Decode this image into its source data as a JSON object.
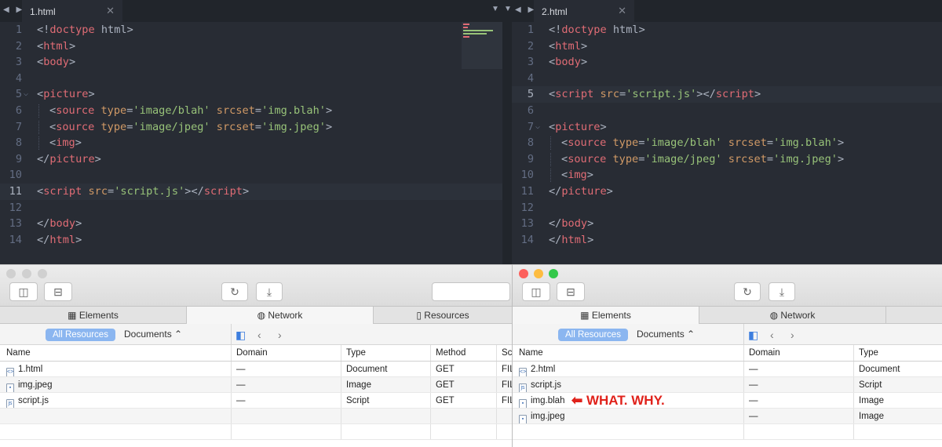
{
  "editor_left": {
    "tab_title": "1.html",
    "lines": [
      {
        "n": "1",
        "tokens": [
          [
            "p",
            "<!"
          ],
          [
            "t",
            "doctype"
          ],
          [
            "k",
            " html"
          ],
          [
            "p",
            ">"
          ]
        ]
      },
      {
        "n": "2",
        "tokens": [
          [
            "p",
            "<"
          ],
          [
            "t",
            "html"
          ],
          [
            "p",
            ">"
          ]
        ]
      },
      {
        "n": "3",
        "tokens": [
          [
            "p",
            "<"
          ],
          [
            "t",
            "body"
          ],
          [
            "p",
            ">"
          ]
        ]
      },
      {
        "n": "4",
        "tokens": []
      },
      {
        "n": "5",
        "fold": true,
        "tokens": [
          [
            "p",
            "<"
          ],
          [
            "t",
            "picture"
          ],
          [
            "p",
            ">"
          ]
        ]
      },
      {
        "n": "6",
        "indent": true,
        "tokens": [
          [
            "p",
            "<"
          ],
          [
            "t",
            "source"
          ],
          [
            "a",
            " type"
          ],
          [
            "p",
            "="
          ],
          [
            "s",
            "'image/blah'"
          ],
          [
            "a",
            " srcset"
          ],
          [
            "p",
            "="
          ],
          [
            "s",
            "'img.blah'"
          ],
          [
            "p",
            ">"
          ]
        ]
      },
      {
        "n": "7",
        "indent": true,
        "tokens": [
          [
            "p",
            "<"
          ],
          [
            "t",
            "source"
          ],
          [
            "a",
            " type"
          ],
          [
            "p",
            "="
          ],
          [
            "s",
            "'image/jpeg'"
          ],
          [
            "a",
            " srcset"
          ],
          [
            "p",
            "="
          ],
          [
            "s",
            "'img.jpeg'"
          ],
          [
            "p",
            ">"
          ]
        ]
      },
      {
        "n": "8",
        "indent": true,
        "tokens": [
          [
            "p",
            "<"
          ],
          [
            "t",
            "img"
          ],
          [
            "p",
            ">"
          ]
        ]
      },
      {
        "n": "9",
        "tokens": [
          [
            "p",
            "</"
          ],
          [
            "t",
            "picture"
          ],
          [
            "p",
            ">"
          ]
        ]
      },
      {
        "n": "10",
        "tokens": []
      },
      {
        "n": "11",
        "highlight": true,
        "tokens": [
          [
            "p",
            "<"
          ],
          [
            "t",
            "script"
          ],
          [
            "a",
            " src"
          ],
          [
            "p",
            "="
          ],
          [
            "s",
            "'script.js'"
          ],
          [
            "p",
            "></"
          ],
          [
            "t",
            "script"
          ],
          [
            "p",
            ">"
          ]
        ]
      },
      {
        "n": "12",
        "tokens": []
      },
      {
        "n": "13",
        "tokens": [
          [
            "p",
            "</"
          ],
          [
            "t",
            "body"
          ],
          [
            "p",
            ">"
          ]
        ]
      },
      {
        "n": "14",
        "tokens": [
          [
            "p",
            "</"
          ],
          [
            "t",
            "html"
          ],
          [
            "p",
            ">"
          ]
        ]
      }
    ]
  },
  "editor_right": {
    "tab_title": "2.html",
    "lines": [
      {
        "n": "1",
        "tokens": [
          [
            "p",
            "<!"
          ],
          [
            "t",
            "doctype"
          ],
          [
            "k",
            " html"
          ],
          [
            "p",
            ">"
          ]
        ]
      },
      {
        "n": "2",
        "tokens": [
          [
            "p",
            "<"
          ],
          [
            "t",
            "html"
          ],
          [
            "p",
            ">"
          ]
        ]
      },
      {
        "n": "3",
        "tokens": [
          [
            "p",
            "<"
          ],
          [
            "t",
            "body"
          ],
          [
            "p",
            ">"
          ]
        ]
      },
      {
        "n": "4",
        "tokens": []
      },
      {
        "n": "5",
        "highlight": true,
        "tokens": [
          [
            "p",
            "<"
          ],
          [
            "t",
            "script"
          ],
          [
            "a",
            " src"
          ],
          [
            "p",
            "="
          ],
          [
            "s",
            "'script.js'"
          ],
          [
            "p",
            "></"
          ],
          [
            "t",
            "script"
          ],
          [
            "p",
            ">"
          ]
        ]
      },
      {
        "n": "6",
        "tokens": []
      },
      {
        "n": "7",
        "fold": true,
        "tokens": [
          [
            "p",
            "<"
          ],
          [
            "t",
            "picture"
          ],
          [
            "p",
            ">"
          ]
        ]
      },
      {
        "n": "8",
        "indent": true,
        "tokens": [
          [
            "p",
            "<"
          ],
          [
            "t",
            "source"
          ],
          [
            "a",
            " type"
          ],
          [
            "p",
            "="
          ],
          [
            "s",
            "'image/blah'"
          ],
          [
            "a",
            " srcset"
          ],
          [
            "p",
            "="
          ],
          [
            "s",
            "'img.blah'"
          ],
          [
            "p",
            ">"
          ]
        ]
      },
      {
        "n": "9",
        "indent": true,
        "tokens": [
          [
            "p",
            "<"
          ],
          [
            "t",
            "source"
          ],
          [
            "a",
            " type"
          ],
          [
            "p",
            "="
          ],
          [
            "s",
            "'image/jpeg'"
          ],
          [
            "a",
            " srcset"
          ],
          [
            "p",
            "="
          ],
          [
            "s",
            "'img.jpeg'"
          ],
          [
            "p",
            ">"
          ]
        ]
      },
      {
        "n": "10",
        "indent": true,
        "tokens": [
          [
            "p",
            "<"
          ],
          [
            "t",
            "img"
          ],
          [
            "p",
            ">"
          ]
        ]
      },
      {
        "n": "11",
        "tokens": [
          [
            "p",
            "</"
          ],
          [
            "t",
            "picture"
          ],
          [
            "p",
            ">"
          ]
        ]
      },
      {
        "n": "12",
        "tokens": []
      },
      {
        "n": "13",
        "tokens": [
          [
            "p",
            "</"
          ],
          [
            "t",
            "body"
          ],
          [
            "p",
            ">"
          ]
        ]
      },
      {
        "n": "14",
        "tokens": [
          [
            "p",
            "</"
          ],
          [
            "t",
            "html"
          ],
          [
            "p",
            ">"
          ]
        ]
      }
    ]
  },
  "devtools_left": {
    "tabs": [
      "Elements",
      "Network",
      "Resources"
    ],
    "filter_all": "All Resources",
    "filter_docs": "Documents",
    "columns": [
      "Name",
      "Domain",
      "Type",
      "Method",
      "Sc"
    ],
    "rows": [
      [
        "1.html",
        "—",
        "Document",
        "GET",
        "FIL"
      ],
      [
        "img.jpeg",
        "—",
        "Image",
        "GET",
        "FIL"
      ],
      [
        "script.js",
        "—",
        "Script",
        "GET",
        "FIL"
      ]
    ]
  },
  "devtools_right": {
    "tabs": [
      "Elements",
      "Network"
    ],
    "filter_all": "All Resources",
    "filter_docs": "Documents",
    "columns": [
      "Name",
      "Domain",
      "Type"
    ],
    "rows": [
      [
        "2.html",
        "—",
        "Document"
      ],
      [
        "script.js",
        "—",
        "Script"
      ],
      [
        "img.blah",
        "—",
        "Image"
      ],
      [
        "img.jpeg",
        "—",
        "Image"
      ]
    ]
  },
  "annotation": "WHAT. WHY.",
  "colors": {
    "tag": "#e06c75",
    "attr": "#d19a66",
    "string": "#98c379",
    "annotation": "#e0221b",
    "traffic_red": "#fc605c",
    "traffic_yellow": "#fdbc40",
    "traffic_green": "#34c84a"
  }
}
